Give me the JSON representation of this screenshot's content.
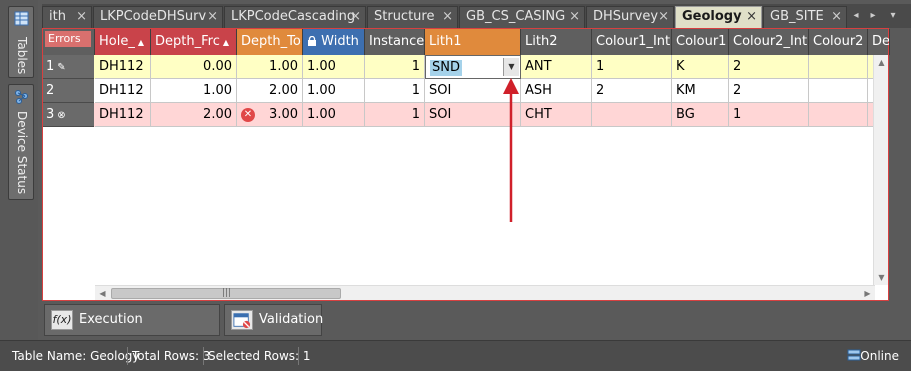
{
  "side_panel": {
    "tables_label": "Tables",
    "device_status_label": "Device Status"
  },
  "tabs": [
    {
      "label": "ith",
      "active": false
    },
    {
      "label": "LKPCodeDHSurv",
      "active": false
    },
    {
      "label": "LKPCodeCascading",
      "active": false
    },
    {
      "label": "Structure",
      "active": false
    },
    {
      "label": "GB_CS_CASING",
      "active": false
    },
    {
      "label": "DHSurvey",
      "active": false
    },
    {
      "label": "Geology",
      "active": true
    },
    {
      "label": "GB_SITE",
      "active": false
    }
  ],
  "tab_close_glyph": "×",
  "grid": {
    "errors_label": "Errors",
    "columns": [
      {
        "label": "Hole_",
        "sort": "▲"
      },
      {
        "label": "Depth_Frc",
        "sort": "▲"
      },
      {
        "label": "Depth_To",
        "sort": ""
      },
      {
        "label": "Width",
        "sort": ""
      },
      {
        "label": "Instance",
        "sort": ""
      },
      {
        "label": "Lith1",
        "sort": ""
      },
      {
        "label": "Lith2",
        "sort": ""
      },
      {
        "label": "Colour1_Int",
        "sort": ""
      },
      {
        "label": "Colour1",
        "sort": ""
      },
      {
        "label": "Colour2_Int",
        "sort": ""
      },
      {
        "label": "Colour2",
        "sort": ""
      },
      {
        "label": "De",
        "sort": ""
      }
    ],
    "rows": [
      {
        "row_num": "1",
        "marker": "✎",
        "status": "editing",
        "cells": [
          "DH112",
          "0.00",
          "1.00",
          "1.00",
          "1",
          "SND",
          "ANT",
          "1",
          "K",
          "2",
          "",
          ""
        ]
      },
      {
        "row_num": "2",
        "marker": "",
        "status": "normal",
        "cells": [
          "DH112",
          "1.00",
          "2.00",
          "1.00",
          "1",
          "SOI",
          "ASH",
          "2",
          "KM",
          "2",
          "",
          ""
        ]
      },
      {
        "row_num": "3",
        "marker": "⊗",
        "status": "error",
        "cells": [
          "DH112",
          "2.00",
          "3.00",
          "1.00",
          "1",
          "SOI",
          "CHT",
          "",
          "BG",
          "1",
          "",
          ""
        ]
      }
    ],
    "error_glyph": "✕",
    "dropdown_glyph": "▼",
    "scroll_grip": "|||"
  },
  "bottom_tabs": {
    "execution_parameters": "Execution Parameters",
    "execution_icon_text": "f(x)",
    "validation": "Validation"
  },
  "status": {
    "table_name": "Table Name: Geology",
    "total_rows": "Total Rows: 3",
    "selected_rows": "Selected Rows: 1",
    "online": "Online"
  },
  "colors": {
    "editing_row": "#ffffc4",
    "error_row": "#ffd6d6",
    "red_header": "#c9434a",
    "orange_header": "#e08a3c",
    "blue_header": "#3d6fb0",
    "active_tab": "#e0e0c8",
    "annotation_arrow": "#d0202a"
  }
}
